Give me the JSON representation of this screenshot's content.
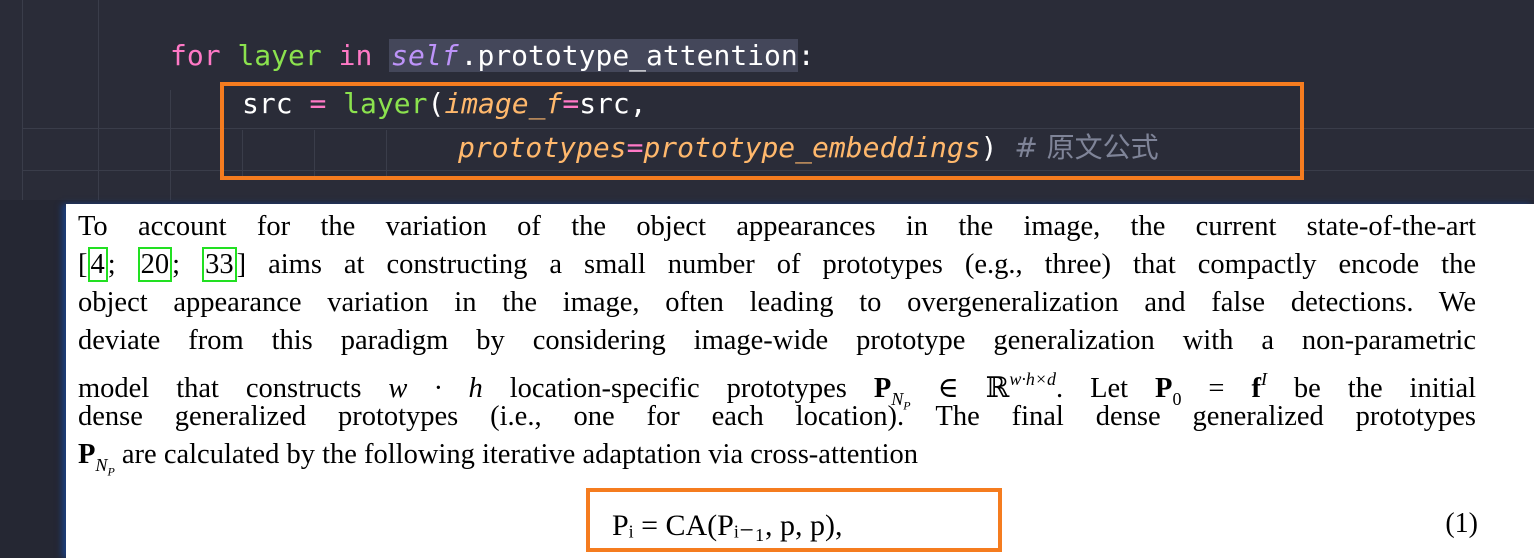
{
  "code": {
    "line1": {
      "kw_for": "for",
      "var_layer": "layer",
      "kw_in": "in",
      "self": "self",
      "attr": ".prototype_attention",
      "colon": ":"
    },
    "line2": {
      "var_src": "src",
      "eq": "=",
      "fn": "layer",
      "open": "(",
      "param": "image_f",
      "peq": "=",
      "val": "src",
      "comma": ","
    },
    "line3": {
      "param": "prototypes",
      "peq": "=",
      "val": "prototype_embeddings",
      "close": ")",
      "comment": "# 原文公式"
    }
  },
  "paper": {
    "lines": [
      "To account for the variation of the object appearances in the image, the current state-of-the-art",
      "] aims at constructing a small number of prototypes (e.g., three) that compactly encode the",
      "object appearance variation in the image, often leading to overgeneralization and false detections. We",
      "deviate from this paradigm by considering image-wide prototype generalization with a non-parametric",
      "model that constructs",
      "location-specific prototypes",
      ". Let",
      "be the initial",
      "dense generalized prototypes (i.e., one for each location). The final dense generalized prototypes",
      "are calculated by the following iterative adaptation via cross-attention"
    ],
    "citations": [
      "4",
      "20",
      "33"
    ],
    "equation": "Pᵢ = CA(Pᵢ₋₁, p, p),",
    "equation_number": "(1)"
  },
  "colors": {
    "highlight_box": "#f57c1f",
    "citation_box": "#22e022",
    "editor_bg": "#2a2c38"
  }
}
